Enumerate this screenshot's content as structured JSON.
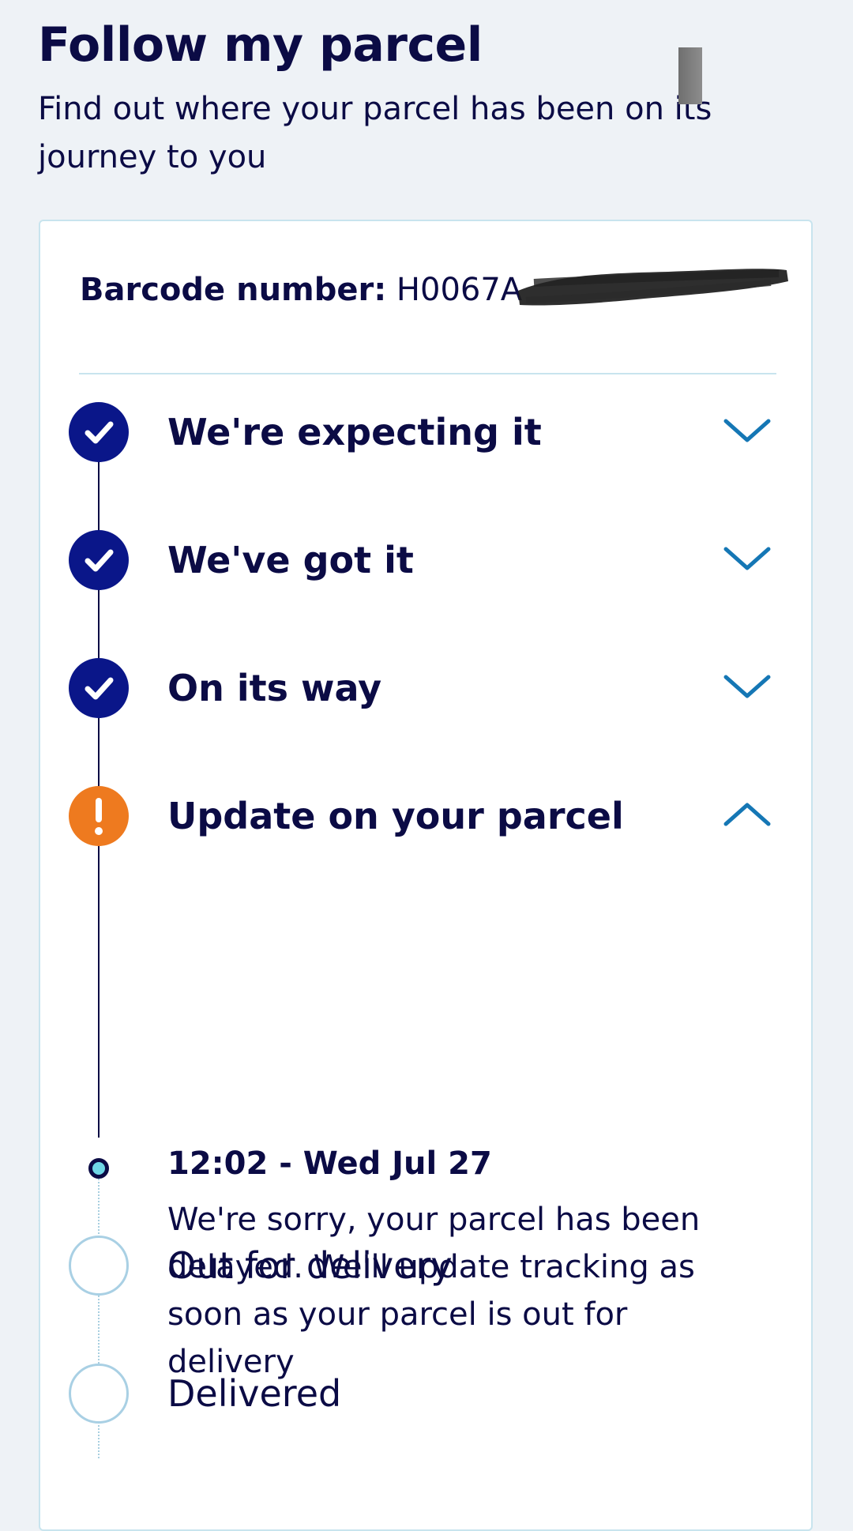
{
  "page": {
    "title": "Follow my parcel",
    "subtitle": "Find out where your parcel has been on its journey to you"
  },
  "barcode": {
    "label": "Barcode number:",
    "value_visible": "H0067A"
  },
  "steps": [
    {
      "label": "We're expecting it",
      "status": "complete",
      "icon": "check-icon",
      "expand_icon": "chevron-down-icon"
    },
    {
      "label": "We've got it",
      "status": "complete",
      "icon": "check-icon",
      "expand_icon": "chevron-down-icon"
    },
    {
      "label": "On its way",
      "status": "complete",
      "icon": "check-icon",
      "expand_icon": "chevron-down-icon"
    },
    {
      "label": "Update on your parcel",
      "status": "alert",
      "icon": "exclamation-icon",
      "expand_icon": "chevron-up-icon"
    },
    {
      "label": "Out for delivery",
      "status": "pending",
      "icon": "empty-circle-icon"
    },
    {
      "label": "Delivered",
      "status": "pending",
      "icon": "empty-circle-icon"
    }
  ],
  "update_event": {
    "time": "12:02 - Wed Jul 27",
    "description": "We're sorry, your parcel has been delayed. We'll update tracking as soon as your parcel is out for delivery"
  },
  "colors": {
    "background": "#eef2f6",
    "navy_text": "#0b0b45",
    "step_complete": "#0a1689",
    "step_alert": "#ee7a1f",
    "step_pending_border": "#a9d0e4",
    "chevron": "#1577b5",
    "card_border": "#c8e4ee",
    "event_dot": "#6fd6e6"
  }
}
